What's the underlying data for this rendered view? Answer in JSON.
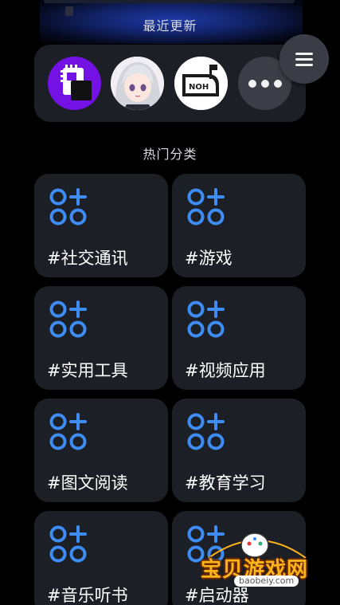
{
  "recent": {
    "title": "最近更新",
    "apps": [
      {
        "name": "chip-app-icon",
        "color": "#7412e6"
      },
      {
        "name": "anime-avatar-icon",
        "color": "#e9e9ee"
      },
      {
        "name": "noh-mailbox-icon",
        "color": "#ffffff",
        "label": "NOH"
      },
      {
        "name": "more-apps-icon",
        "color": "#3b3e46"
      }
    ]
  },
  "menu": {
    "icon": "hamburger-menu-icon"
  },
  "hot": {
    "title": "热门分类",
    "categories": [
      {
        "label": "#社交通讯"
      },
      {
        "label": "#游戏"
      },
      {
        "label": "#实用工具"
      },
      {
        "label": "#视频应用"
      },
      {
        "label": "#图文阅读"
      },
      {
        "label": "#教育学习"
      },
      {
        "label": "#音乐听书"
      },
      {
        "label": "#启动器"
      }
    ]
  },
  "colors": {
    "accent": "#3d8df5",
    "card": "#1c1f26",
    "background": "#000000"
  },
  "watermark": {
    "text": "宝贝游戏网",
    "url": "baobeiy.com"
  }
}
